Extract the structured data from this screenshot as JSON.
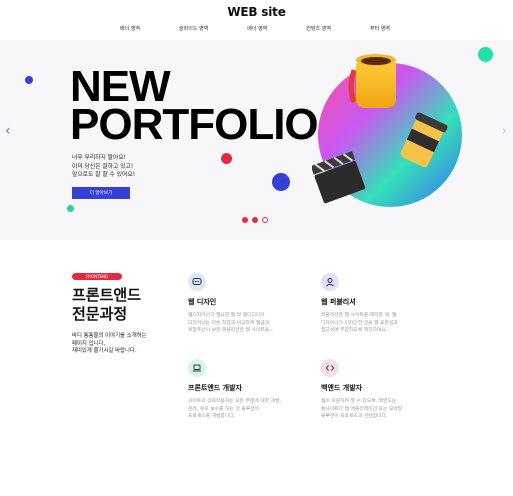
{
  "header": {
    "title": "WEB site",
    "nav": [
      "배너 영역",
      "슬라이드 영역",
      "배너 영역",
      "컨텐츠 영역",
      "푸터 영역"
    ]
  },
  "hero": {
    "title_line1": "NEW",
    "title_line2": "PORTFOLIO",
    "desc": [
      "너무 무리하지 말아요!",
      "이미 당신은 잘하고 있고!",
      "앞으로도 잘 할 수 있어요!"
    ],
    "button_label": "더 알아보기",
    "prev_arrow": "‹",
    "next_arrow": "›"
  },
  "section": {
    "tag": "FRONTEND",
    "title_line1": "프론트앤드",
    "title_line2": "전문과정",
    "desc": [
      "바디 통통물의 이야기를 소개하는",
      "페이지 입니다.",
      "재미있게 즐기시길 바랍니다."
    ]
  },
  "cards": [
    {
      "title": "웹 디자인",
      "desc": [
        "웹디자이너가 필요한 웹 및 웹디디디어",
        "디자이너는 다른 작업과 비교하여 웹급과",
        "복잡추선이 낮은 퍼블리션은 웹 사이트을..."
      ]
    },
    {
      "title": "웹 퍼블리셔",
      "desc": [
        "퍼블리션은 웹 사이트를 제작할 때, 웹",
        "디자이너가 디자인한 것을 웹 표준성과",
        "접근성에 부합하도록 제작하여요."
      ]
    },
    {
      "title": "프론트앤드 개발자",
      "desc": [
        "사이트의 상호작용하는 모든 부분에 대한 개발,",
        "온라, 유지 보수를 하는 것 솔루션이",
        "프로세스를 개발합니다."
      ]
    },
    {
      "title": "백앤드 개발자",
      "desc": [
        "웹이 지원하여 할 수 있도록, 백앤드는",
        "통사이트나 웹 애플리케이션 또는 모바일",
        "솔루션이 프로세스과 관련입니다."
      ]
    }
  ],
  "colors": {
    "accent_blue": "#3440d6",
    "accent_red": "#e8283f",
    "card_icon_blue": "#d8e9fb",
    "card_icon_purple": "#e6dcfb",
    "card_icon_green": "#d5f5e6",
    "card_icon_pink": "#f9dcec"
  },
  "icons": {
    "card1": "chat-bubble-icon",
    "card2": "person-icon",
    "card3": "laptop-icon",
    "card4": "code-icon"
  }
}
